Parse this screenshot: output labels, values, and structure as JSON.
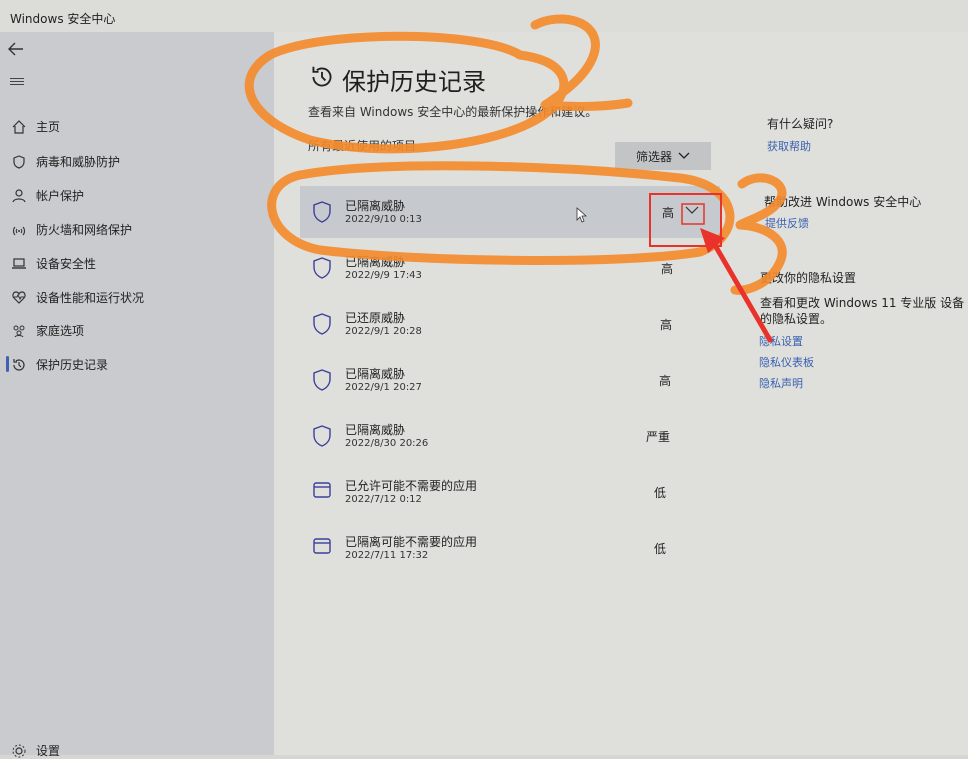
{
  "app": {
    "title": "Windows 安全中心",
    "min": "—",
    "max": "▢"
  },
  "nav": {
    "back_icon": "back-arrow-icon",
    "items": [
      {
        "label": "主页",
        "icon": "home-icon"
      },
      {
        "label": "病毒和威胁防护",
        "icon": "shield-icon"
      },
      {
        "label": "帐户保护",
        "icon": "person-icon"
      },
      {
        "label": "防火墙和网络保护",
        "icon": "wifi-icon"
      },
      {
        "label": "设备安全性",
        "icon": "laptop-icon"
      },
      {
        "label": "设备性能和运行状况",
        "icon": "heart-icon"
      },
      {
        "label": "家庭选项",
        "icon": "family-icon"
      },
      {
        "label": "保护历史记录",
        "icon": "history-icon"
      }
    ],
    "settings_label": "设置"
  },
  "main": {
    "title": "保护历史记录",
    "subtitle": "查看来自 Windows 安全中心的最新保护操作和建议。",
    "recent_label": "所有最近使用的项目",
    "filter_label": "筛选器",
    "items": [
      {
        "name": "已隔离威胁",
        "date": "2022/9/10 0:13",
        "severity": "高",
        "icon": "shield-icon"
      },
      {
        "name": "已隔离威胁",
        "date": "2022/9/9 17:43",
        "severity": "高",
        "icon": "shield-icon"
      },
      {
        "name": "已还原威胁",
        "date": "2022/9/1 20:28",
        "severity": "高",
        "icon": "shield-icon"
      },
      {
        "name": "已隔离威胁",
        "date": "2022/9/1 20:27",
        "severity": "高",
        "icon": "shield-icon"
      },
      {
        "name": "已隔离威胁",
        "date": "2022/8/30 20:26",
        "severity": "严重",
        "icon": "shield-icon"
      },
      {
        "name": "已允许可能不需要的应用",
        "date": "2022/7/12 0:12",
        "severity": "低",
        "icon": "app-window-icon"
      },
      {
        "name": "已隔离可能不需要的应用",
        "date": "2022/7/11 17:32",
        "severity": "低",
        "icon": "app-window-icon"
      }
    ]
  },
  "side": {
    "question_heading": "有什么疑问?",
    "get_help": "获取帮助",
    "improve_heading": "帮助改进 Windows 安全中心",
    "feedback": "提供反馈",
    "privacy_heading": "更改你的隐私设置",
    "privacy_text_1": "查看和更改 Windows 11 专业版 设备",
    "privacy_text_2": "的隐私设置。",
    "privacy_settings": "隐私设置",
    "privacy_dashboard": "隐私仪表板",
    "privacy_statement": "隐私声明"
  },
  "annotations": {
    "marker_color": "#f58a2a",
    "arrow_color": "#e8322a",
    "number_2": "2",
    "number_3": "3"
  }
}
